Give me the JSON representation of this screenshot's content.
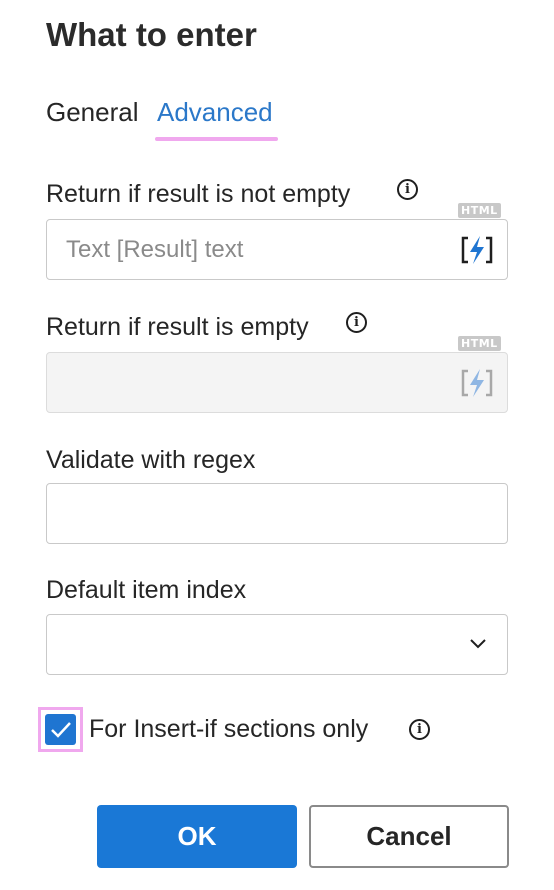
{
  "dialog": {
    "title": "What to enter"
  },
  "tabs": [
    {
      "label": "General",
      "active": false
    },
    {
      "label": "Advanced",
      "active": true
    }
  ],
  "fields": {
    "not_empty": {
      "label": "Return if result is not empty",
      "badge": "HTML",
      "placeholder": "Text [Result] text",
      "value": "",
      "icon": "lightning-bolt-icon"
    },
    "empty": {
      "label": "Return if result is empty",
      "badge": "HTML",
      "placeholder": "",
      "value": "",
      "disabled": true,
      "icon": "lightning-bolt-icon"
    },
    "regex": {
      "label": "Validate with regex",
      "value": ""
    },
    "index": {
      "label": "Default item index",
      "value": ""
    }
  },
  "checkbox": {
    "label": "For Insert-if sections only",
    "checked": true
  },
  "buttons": {
    "ok": "OK",
    "cancel": "Cancel"
  },
  "colors": {
    "accent": "#1a78d6",
    "tab_active": "#2b78c9",
    "highlight": "#f0a8ee"
  }
}
